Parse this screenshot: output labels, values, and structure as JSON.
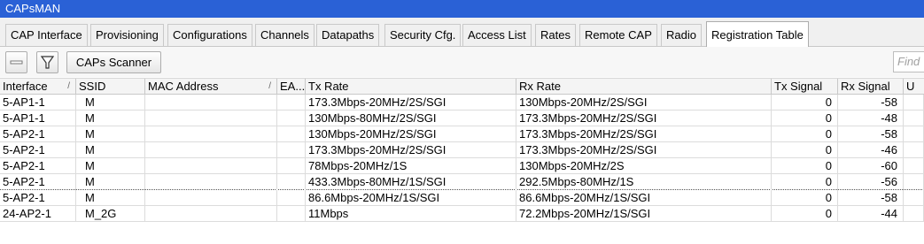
{
  "window": {
    "title": "CAPsMAN"
  },
  "tabs": [
    {
      "label": "CAP Interface"
    },
    {
      "label": "Provisioning"
    },
    {
      "label": "Configurations"
    },
    {
      "label": "Channels"
    },
    {
      "label": "Datapaths"
    },
    {
      "label": "Security Cfg."
    },
    {
      "label": "Access List"
    },
    {
      "label": "Rates"
    },
    {
      "label": "Remote CAP"
    },
    {
      "label": "Radio"
    },
    {
      "label": "Registration Table",
      "active": true
    }
  ],
  "toolbar": {
    "remove_icon": "minus-icon",
    "filter_icon": "filter-icon",
    "scanner_label": "CAPs Scanner",
    "find_placeholder": "Find"
  },
  "table": {
    "columns": [
      "Interface",
      "SSID",
      "MAC Address",
      "EA...",
      "Tx Rate",
      "Rx Rate",
      "Tx Signal",
      "Rx Signal",
      "U"
    ],
    "sort_column": "Interface",
    "rows": [
      {
        "interface": "5-AP1-1",
        "ssid": "M",
        "mac": "",
        "ea": "",
        "tx_rate": "173.3Mbps-20MHz/2S/SGI",
        "rx_rate": "130Mbps-20MHz/2S/SGI",
        "tx_signal": "0",
        "rx_signal": "-58"
      },
      {
        "interface": "5-AP1-1",
        "ssid": "M",
        "mac": "",
        "ea": "",
        "tx_rate": "130Mbps-80MHz/2S/SGI",
        "rx_rate": "173.3Mbps-20MHz/2S/SGI",
        "tx_signal": "0",
        "rx_signal": "-48"
      },
      {
        "interface": "5-AP2-1",
        "ssid": "M",
        "mac": "",
        "ea": "",
        "tx_rate": "130Mbps-20MHz/2S/SGI",
        "rx_rate": "173.3Mbps-20MHz/2S/SGI",
        "tx_signal": "0",
        "rx_signal": "-58"
      },
      {
        "interface": "5-AP2-1",
        "ssid": "M",
        "mac": "",
        "ea": "",
        "tx_rate": "173.3Mbps-20MHz/2S/SGI",
        "rx_rate": "173.3Mbps-20MHz/2S/SGI",
        "tx_signal": "0",
        "rx_signal": "-46"
      },
      {
        "interface": "5-AP2-1",
        "ssid": "M",
        "mac": "",
        "ea": "",
        "tx_rate": "78Mbps-20MHz/1S",
        "rx_rate": "130Mbps-20MHz/2S",
        "tx_signal": "0",
        "rx_signal": "-60"
      },
      {
        "interface": "5-AP2-1",
        "ssid": "M",
        "mac": "",
        "ea": "",
        "tx_rate": "433.3Mbps-80MHz/1S/SGI",
        "rx_rate": "292.5Mbps-80MHz/1S",
        "tx_signal": "0",
        "rx_signal": "-56",
        "selected": true
      },
      {
        "interface": "5-AP2-1",
        "ssid": "M",
        "mac": "",
        "ea": "",
        "tx_rate": "86.6Mbps-20MHz/1S/SGI",
        "rx_rate": "86.6Mbps-20MHz/1S/SGI",
        "tx_signal": "0",
        "rx_signal": "-58"
      },
      {
        "interface": "24-AP2-1",
        "ssid": "M_2G",
        "mac": "",
        "ea": "",
        "tx_rate": "11Mbps",
        "rx_rate": "72.2Mbps-20MHz/1S/SGI",
        "tx_signal": "0",
        "rx_signal": "-44"
      }
    ]
  },
  "colors": {
    "titlebar": "#2a61d6",
    "tab_bg": "#f0f0f0",
    "grid_line": "#dcdcdc"
  }
}
